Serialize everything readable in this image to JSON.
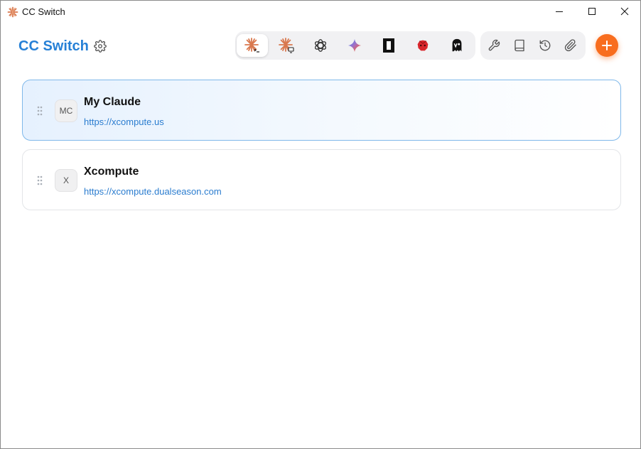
{
  "window": {
    "title": "CC Switch",
    "controls": [
      "minimize-icon",
      "maximize-icon",
      "close-icon"
    ]
  },
  "header": {
    "title": "CC Switch",
    "settings_icon": "gear-icon",
    "app_tabs": [
      {
        "name": "claude-code-icon",
        "active": true
      },
      {
        "name": "claude-desktop-icon",
        "active": false
      },
      {
        "name": "openai-icon",
        "active": false
      },
      {
        "name": "gemini-icon",
        "active": false
      },
      {
        "name": "opencode-icon",
        "active": false
      },
      {
        "name": "red-robot-icon",
        "active": false
      },
      {
        "name": "ghost-icon",
        "active": false
      }
    ],
    "tools": [
      "wrench-icon",
      "book-icon",
      "history-icon",
      "paperclip-icon"
    ],
    "add_icon": "plus-icon"
  },
  "providers": [
    {
      "avatar": "MC",
      "name": "My Claude",
      "url": "https://xcompute.us",
      "active": true
    },
    {
      "avatar": "X",
      "name": "Xcompute",
      "url": "https://xcompute.dualseason.com",
      "active": false
    }
  ],
  "colors": {
    "accent": "#2680d6",
    "add_button": "#f86d1e",
    "link": "#2a7ccf",
    "active_border": "#7fb8ea"
  }
}
